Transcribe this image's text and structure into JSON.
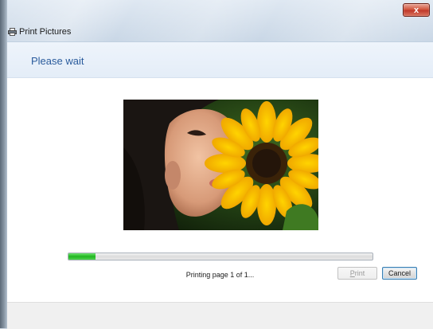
{
  "window": {
    "title": "Print Pictures",
    "close_glyph": "x",
    "icon": "printer-icon"
  },
  "header": {
    "title": "Please wait"
  },
  "preview": {
    "image": "photo of a child smelling a sunflower"
  },
  "progress": {
    "percent": 9,
    "status": "Printing page 1 of 1..."
  },
  "footer": {
    "print_label_accel": "P",
    "print_label_rest": "rint",
    "print_enabled": false,
    "cancel_label": "Cancel"
  },
  "colors": {
    "header_text": "#2a5b9c",
    "progress_fill": "#20b520",
    "close_button": "#c0392b"
  }
}
